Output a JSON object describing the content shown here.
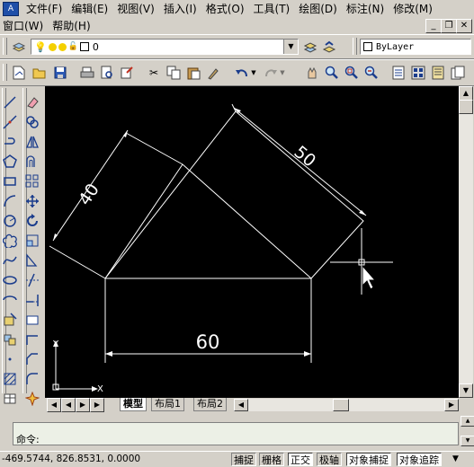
{
  "menu": {
    "row1": [
      "文件(F)",
      "编辑(E)",
      "视图(V)",
      "插入(I)",
      "格式(O)",
      "工具(T)",
      "绘图(D)",
      "标注(N)",
      "修改(M)"
    ],
    "row2": [
      "窗口(W)",
      "帮助(H)"
    ]
  },
  "window_controls": {
    "minimize": "_",
    "restore": "❐",
    "close": "✕"
  },
  "layer_toolbar": {
    "layer_value": "0",
    "linetype_value": "ByLayer"
  },
  "drawing": {
    "dimensions": [
      "40",
      "50",
      "60"
    ],
    "ucs": {
      "x_label": "X",
      "y_label": "Y"
    }
  },
  "layout_tabs": [
    "模型",
    "布局1",
    "布局2"
  ],
  "command": {
    "prompt": "命令:"
  },
  "status": {
    "coordinates": "-469.5744,  826.8531,  0.0000",
    "toggles": [
      "捕捉",
      "栅格",
      "正交",
      "极轴",
      "对象捕捉",
      "对象追踪"
    ]
  },
  "colors": {
    "canvas": "#000000",
    "entity": "#ffffff",
    "chrome": "#d4d0c8",
    "command_bg": "#ecf0e6"
  }
}
